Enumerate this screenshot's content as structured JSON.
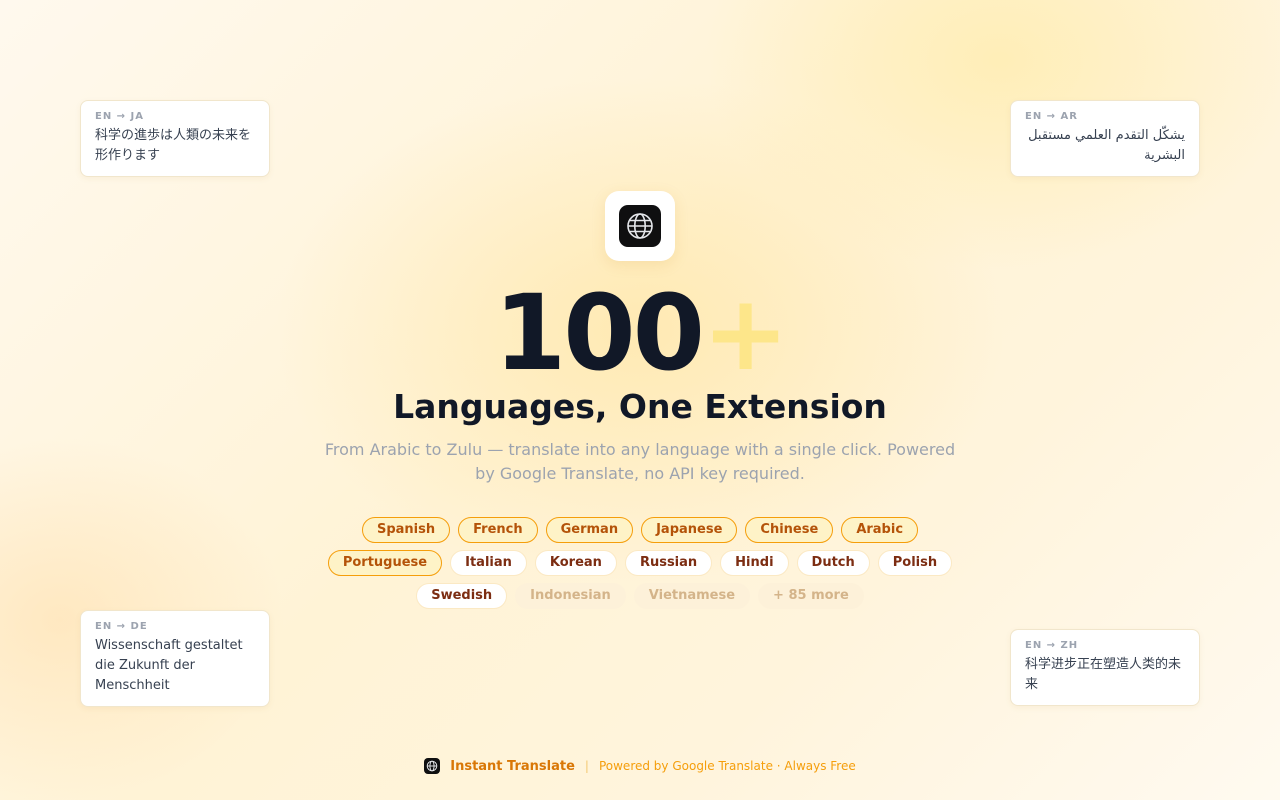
{
  "cards": [
    {
      "id": "ja",
      "code": "EN → JA",
      "text": "科学の進歩は人類の未来を形作ります",
      "rtl": false
    },
    {
      "id": "ar",
      "code": "EN → AR",
      "text": "يشكّل التقدم العلمي مستقبل البشرية",
      "rtl": true
    },
    {
      "id": "de",
      "code": "EN → DE",
      "text": "Wissenschaft gestaltet die Zukunft der Menschheit",
      "rtl": false
    },
    {
      "id": "zh",
      "code": "EN → ZH",
      "text": "科学进步正在塑造人类的未来",
      "rtl": false
    }
  ],
  "hero": {
    "number": "100",
    "plus": "+",
    "headline": "Languages, One Extension",
    "subtitle": "From Arabic to Zulu — translate into any language with a single click. Powered by Google Translate, no API key required."
  },
  "chips": [
    [
      {
        "label": "Spanish",
        "style": "hl"
      },
      {
        "label": "French",
        "style": "hl"
      },
      {
        "label": "German",
        "style": "hl"
      },
      {
        "label": "Japanese",
        "style": "hl"
      },
      {
        "label": "Chinese",
        "style": "hl"
      },
      {
        "label": "Arabic",
        "style": "hl"
      }
    ],
    [
      {
        "label": "Portuguese",
        "style": "hl"
      },
      {
        "label": "Italian",
        "style": "pl"
      },
      {
        "label": "Korean",
        "style": "pl"
      },
      {
        "label": "Russian",
        "style": "pl"
      },
      {
        "label": "Hindi",
        "style": "pl"
      },
      {
        "label": "Dutch",
        "style": "pl"
      },
      {
        "label": "Polish",
        "style": "pl"
      }
    ],
    [
      {
        "label": "Swedish",
        "style": "pl"
      },
      {
        "label": "Indonesian",
        "style": "fd"
      },
      {
        "label": "Vietnamese",
        "style": "fd"
      },
      {
        "label": "+ 85 more",
        "style": "fd"
      }
    ]
  ],
  "footer": {
    "name": "Instant Translate",
    "separator": "|",
    "tagline": "Powered by Google Translate · Always Free"
  },
  "icons": {
    "logo": "globe-icon"
  },
  "colors": {
    "accent": "#d97706",
    "highlight_border": "#f59e0b",
    "plus": "#fde68a",
    "title": "#111827"
  }
}
